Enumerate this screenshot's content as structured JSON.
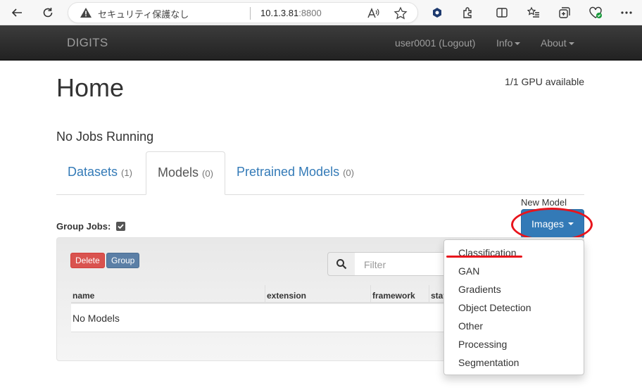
{
  "browser": {
    "security_label": "セキュリティ保護なし",
    "url_host": "10.1.3.81",
    "url_port": ":8800"
  },
  "navbar": {
    "brand": "DIGITS",
    "user": "user0001 (Logout)",
    "info": "Info",
    "about": "About"
  },
  "page": {
    "title": "Home",
    "gpu_status": "1/1 GPU available",
    "jobs_status": "No Jobs Running"
  },
  "tabs": [
    {
      "label": "Datasets",
      "count": "(1)"
    },
    {
      "label": "Models",
      "count": "(0)",
      "active": true
    },
    {
      "label": "Pretrained Models",
      "count": "(0)"
    }
  ],
  "toolbar": {
    "new_model_label": "New Model",
    "images_button": "Images",
    "group_jobs_label": "Group Jobs:",
    "delete_label": "Delete",
    "group_label": "Group",
    "filter_placeholder": "Filter"
  },
  "table": {
    "columns": [
      "name",
      "extension",
      "framework",
      "stat"
    ],
    "empty_message": "No Models"
  },
  "dropdown": {
    "items": [
      "Classification",
      "GAN",
      "Gradients",
      "Object Detection",
      "Other",
      "Processing",
      "Segmentation"
    ]
  },
  "colors": {
    "primary": "#337ab7",
    "danger": "#d9534f",
    "annotation_red": "#e8141c",
    "navbar": "#222222"
  }
}
